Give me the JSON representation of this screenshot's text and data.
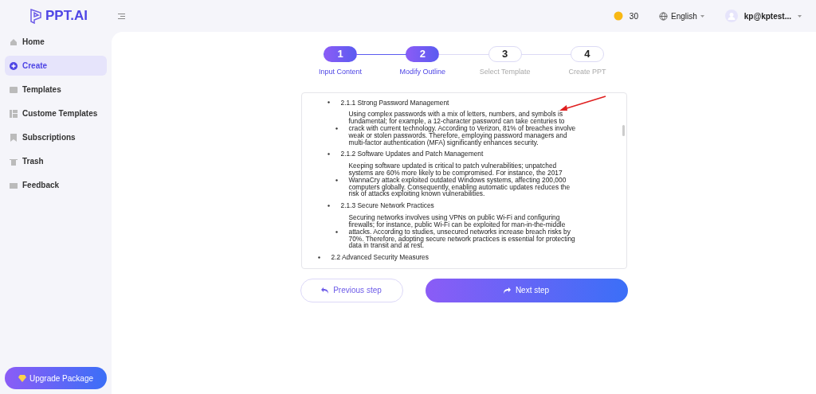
{
  "logo": {
    "text": "PPT.AI"
  },
  "topbar": {
    "credits": "30",
    "language": "English",
    "user": "kp@kptest..."
  },
  "sidebar": {
    "items": [
      {
        "label": "Home",
        "selected": false
      },
      {
        "label": "Create",
        "selected": true
      },
      {
        "label": "Templates",
        "selected": false
      },
      {
        "label": "Custome Templates",
        "selected": false
      },
      {
        "label": "Subscriptions",
        "selected": false
      },
      {
        "label": "Trash",
        "selected": false
      },
      {
        "label": "Feedback",
        "selected": false
      }
    ],
    "upgrade": "Upgrade Package"
  },
  "steps": [
    {
      "number": "1",
      "label": "Input Content",
      "done": true
    },
    {
      "number": "2",
      "label": "Modify Outline",
      "done": true
    },
    {
      "number": "3",
      "label": "Select Template",
      "done": false
    },
    {
      "number": "4",
      "label": "Create PPT",
      "done": false
    }
  ],
  "outline": [
    {
      "kind": "heading",
      "text": "2.1.1 Strong Password Management"
    },
    {
      "kind": "body",
      "text": "Using complex passwords with a mix of letters, numbers, and symbols is fundamental; for example, a 12-character password can take centuries to crack with current technology. According to Verizon, 81% of breaches involve weak or stolen passwords. Therefore, employing password managers and multi-factor authentication (MFA) significantly enhances security."
    },
    {
      "kind": "heading",
      "text": "2.1.2 Software Updates and Patch Management"
    },
    {
      "kind": "body",
      "text": "Keeping software updated is critical to patch vulnerabilities; unpatched systems are 60% more likely to be compromised. For instance, the 2017 WannaCry attack exploited outdated Windows systems, affecting 200,000 computers globally. Consequently, enabling automatic updates reduces the risk of attacks exploiting known vulnerabilities."
    },
    {
      "kind": "heading",
      "text": "2.1.3 Secure Network Practices"
    },
    {
      "kind": "body",
      "text": "Securing networks involves using VPNs on public Wi-Fi and configuring firewalls; for instance, public Wi-Fi can be exploited for man-in-the-middle attacks. According to studies, unsecured networks increase breach risks by 70%. Therefore, adopting secure network practices is essential for protecting data in transit and at rest."
    },
    {
      "kind": "section",
      "text": "2.2 Advanced Security Measures"
    }
  ],
  "buttons": {
    "previous": "Previous step",
    "next": "Next step"
  }
}
